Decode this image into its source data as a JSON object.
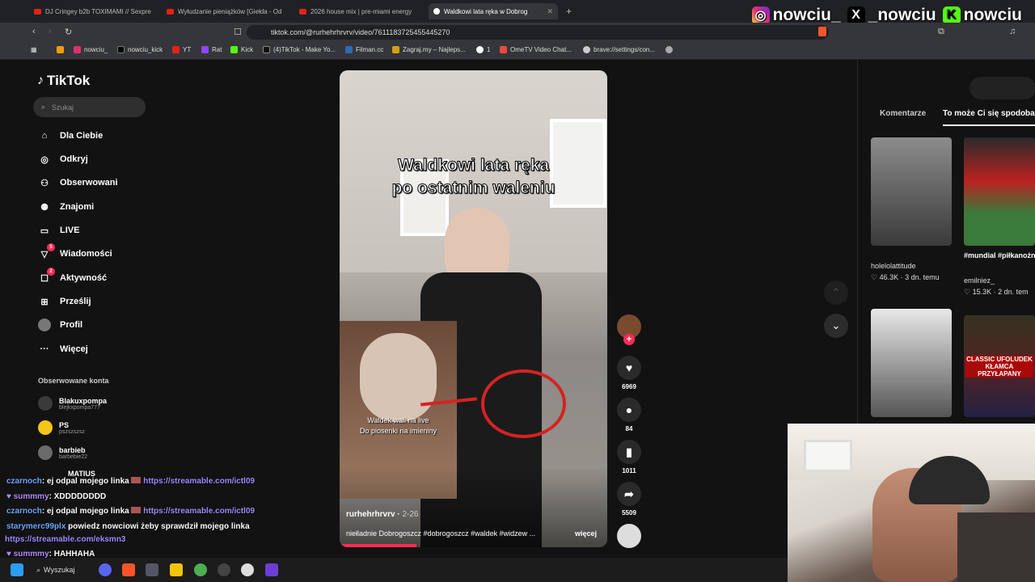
{
  "browser": {
    "tabs": [
      {
        "label": "DJ Cringey b2b TOXIMAMI // Sexpre"
      },
      {
        "label": "Wyłudzanie pieniążków [Giełda - Od"
      },
      {
        "label": "2026 house mix | pre-miami energy"
      },
      {
        "label": "Waldkowi lata ręka w Dobrog"
      }
    ],
    "url": "tiktok.com/@rurhehrhrvrv/video/7611183725455445270",
    "bookmarks": [
      "nowciu_",
      "nowciu_kick",
      "YT",
      "Rat",
      "Kick",
      "(4)TikTok - Make Yo...",
      "Filman.cc",
      "Zagraj.my – Najleps...",
      "1",
      "OmeTV Video Chat...",
      "brave://settings/con..."
    ]
  },
  "social": {
    "instagram": "nowciu_",
    "x": "_nowciu",
    "kick": "nowciu"
  },
  "tiktok": {
    "logo": "TikTok",
    "search_placeholder": "Szukaj",
    "nav": [
      {
        "label": "Dla Ciebie"
      },
      {
        "label": "Odkryj"
      },
      {
        "label": "Obserwowani"
      },
      {
        "label": "Znajomi"
      },
      {
        "label": "LIVE"
      },
      {
        "label": "Wiadomości",
        "badge": "5"
      },
      {
        "label": "Aktywność",
        "badge": "2"
      },
      {
        "label": "Prześlij"
      },
      {
        "label": "Profil"
      },
      {
        "label": "Więcej"
      }
    ],
    "followed_title": "Obserwowane konta",
    "accounts": [
      {
        "name": "Blakuxpompa",
        "handle": "blejkxpompa777"
      },
      {
        "name": "PS",
        "handle": "pszszszsz"
      },
      {
        "name": "barbieb",
        "handle": "barbebie22"
      },
      {
        "name": "MATIUS",
        "handle": ""
      }
    ],
    "video": {
      "caption_line1": "Waldkowi lata ręka",
      "caption_line2": "po ostatnim waleniu",
      "inset_line1": "Waldek wali na live",
      "inset_line2": "Do piosenki na imieniny",
      "author": "rurhehrhrvrv",
      "date": "2-26",
      "description": "niełladnie Dobrogoszcz #dobrogoszcz #waldek #widzew ...",
      "more": "więcej",
      "likes": "6969",
      "comments": "84",
      "saves": "1011",
      "shares": "5509"
    },
    "right_tabs": [
      "Komentarze",
      "To może Ci się spodoba"
    ],
    "recommended": [
      {
        "title": "",
        "author": "holelolattitude",
        "likes": "46.3K",
        "age": "3 dn. temu"
      },
      {
        "title": "#mundial #piłkanożna #dc...",
        "author": "emilniez_",
        "likes": "15.3K",
        "age": "2 dn. tem"
      },
      {
        "title": "",
        "author": "",
        "likes": "",
        "age": ""
      },
      {
        "title": "CLASSIC UFOLUDEK KŁAMCA PRZYŁAPANY",
        "author": "",
        "likes": "",
        "age": ""
      }
    ]
  },
  "chat": [
    {
      "user": "czarnoch",
      "msg": ": ej odpal mojego linka",
      "link": "https://streamable.com/ictl09",
      "color": "#6ea8ff"
    },
    {
      "user": "summmy",
      "msg": ": XDDDDDDDD",
      "link": "",
      "color": "#b48bff"
    },
    {
      "user": "czarnoch",
      "msg": ": ej odpal mojego linka",
      "link": "https://streamable.com/ictl09",
      "color": "#6ea8ff"
    },
    {
      "user": "starymerc99plx",
      "msg": "powiedz nowciowi żeby sprawdził mojego linka",
      "link": "",
      "color": "#6ea8ff"
    },
    {
      "user": "",
      "msg": "",
      "link": "https://streamable.com/eksmn3",
      "color": "#6ea8ff"
    },
    {
      "user": "summmy",
      "msg": ": HAHHAHA",
      "link": "",
      "color": "#b48bff"
    }
  ],
  "taskbar": {
    "search": "Wyszukaj"
  },
  "colors": {
    "accent": "#fe2c55",
    "link": "#9b8cff"
  }
}
